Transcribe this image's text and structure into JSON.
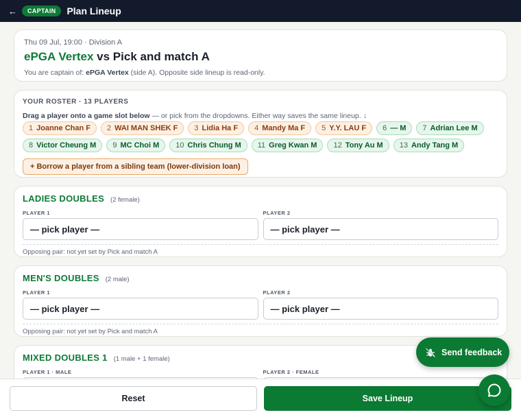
{
  "header": {
    "back_icon": "←",
    "badge": "CAPTAIN",
    "title": "Plan Lineup"
  },
  "match": {
    "meta": "Thu 09 Jul, 19:00 · Division A",
    "home_team": "ePGA Vertex",
    "vs_text": "vs Pick and match A",
    "note_prefix": "You are captain of: ",
    "note_team": "ePGA Vertex",
    "note_suffix": " (side A). Opposite side lineup is read-only."
  },
  "roster": {
    "heading": "YOUR ROSTER · 13 PLAYERS",
    "hint_bold": "Drag a player onto a game slot below",
    "hint_rest": " — or pick from the dropdowns. Either way saves the same lineup. ↓",
    "players": [
      {
        "num": "1",
        "name": "Joanne Chan F",
        "gender": "female"
      },
      {
        "num": "2",
        "name": "WAI MAN SHEK F",
        "gender": "female"
      },
      {
        "num": "3",
        "name": "Lidia Ha F",
        "gender": "female"
      },
      {
        "num": "4",
        "name": "Mandy Ma F",
        "gender": "female"
      },
      {
        "num": "5",
        "name": "Y.Y. LAU F",
        "gender": "female"
      },
      {
        "num": "6",
        "name": "— M",
        "gender": "male"
      },
      {
        "num": "7",
        "name": "Adrian Lee M",
        "gender": "male"
      },
      {
        "num": "8",
        "name": "Victor Cheung M",
        "gender": "male"
      },
      {
        "num": "9",
        "name": "MC Choi M",
        "gender": "male"
      },
      {
        "num": "10",
        "name": "Chris Chung M",
        "gender": "male"
      },
      {
        "num": "11",
        "name": "Greg Kwan M",
        "gender": "male"
      },
      {
        "num": "12",
        "name": "Tony Au M",
        "gender": "male"
      },
      {
        "num": "13",
        "name": "Andy Tang M",
        "gender": "male"
      }
    ],
    "borrow_label": "+ Borrow a player from a sibling team (lower-division loan)"
  },
  "games": [
    {
      "title": "LADIES DOUBLES",
      "sub": "(2 female)",
      "slot1_label": "PLAYER 1",
      "slot1_value": "— pick player —",
      "slot2_label": "PLAYER 2",
      "slot2_value": "— pick player —",
      "opposing": "Opposing pair: not yet set by Pick and match A"
    },
    {
      "title": "MEN'S DOUBLES",
      "sub": "(2 male)",
      "slot1_label": "PLAYER 1",
      "slot1_value": "— pick player —",
      "slot2_label": "PLAYER 2",
      "slot2_value": "— pick player —",
      "opposing": "Opposing pair: not yet set by Pick and match A"
    },
    {
      "title": "MIXED DOUBLES 1",
      "sub": "(1 male + 1 female)",
      "slot1_label": "PLAYER 1 · MALE",
      "slot2_label": "PLAYER 2 · FEMALE"
    }
  ],
  "footer": {
    "reset_label": "Reset",
    "save_label": "Save Lineup"
  },
  "feedback": {
    "label": "Send feedback",
    "icon": "bug-icon"
  },
  "chat": {
    "icon": "chat-bubble-icon"
  },
  "colors": {
    "brand_green": "#0b7a33",
    "topbar": "#121a2b",
    "female_chip_bg": "#fdf0e3",
    "male_chip_bg": "#e6f6ec"
  }
}
